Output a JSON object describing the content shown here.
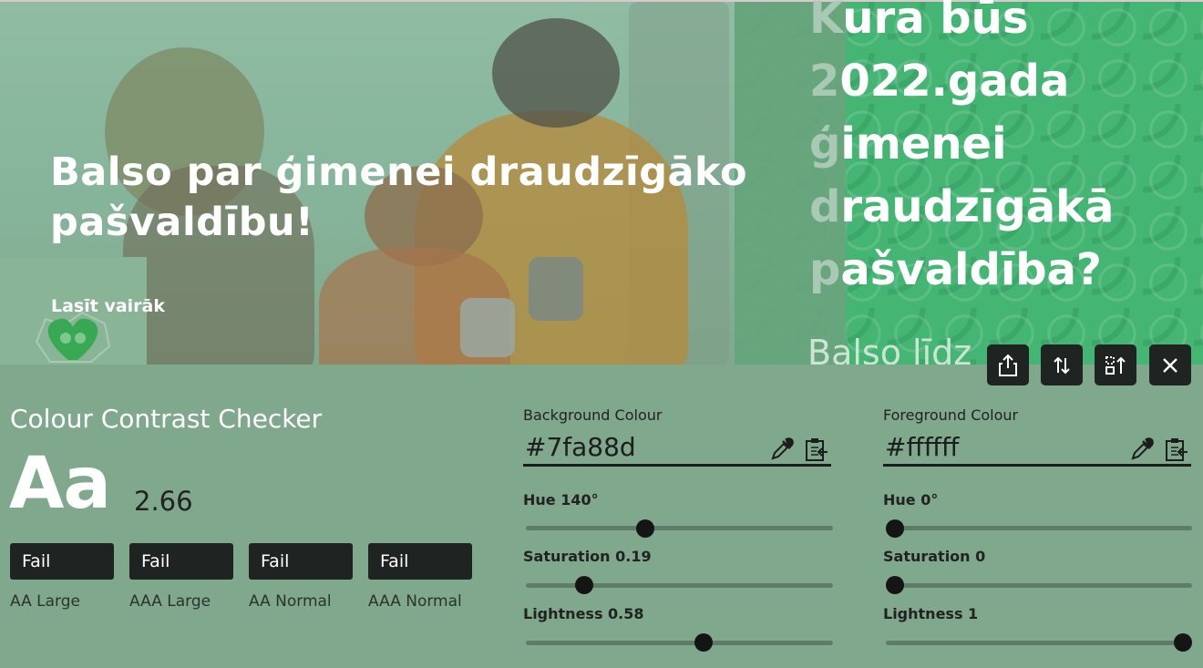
{
  "page": {
    "promo_heading_line1": "Balso par ģimenei draudzīgāko",
    "promo_heading_line2": "pašvaldību!",
    "read_more": "Lasīt vairāk",
    "question_lines": [
      "Kura būs",
      "2022.gada",
      "ģimenei",
      "draudzīgākā",
      "pašvaldība?"
    ],
    "balso": "Balso līdz"
  },
  "toolbar": {
    "buttons": [
      {
        "name": "export-button",
        "icon": "share-icon"
      },
      {
        "name": "swap-colours-button",
        "icon": "swap-arrows-icon"
      },
      {
        "name": "move-panel-button",
        "icon": "dock-move-icon"
      },
      {
        "name": "close-button",
        "icon": "close-icon"
      }
    ]
  },
  "checker": {
    "title": "Colour Contrast Checker",
    "sample_text": "Aa",
    "ratio": "2.66",
    "results": [
      {
        "status": "Fail",
        "label": "AA Large"
      },
      {
        "status": "Fail",
        "label": "AAA Large"
      },
      {
        "status": "Fail",
        "label": "AA Normal"
      },
      {
        "status": "Fail",
        "label": "AAA Normal"
      }
    ]
  },
  "background_colour": {
    "label": "Background Colour",
    "value": "#7fa88d",
    "hue_label": "Hue 140°",
    "hue": 140,
    "saturation_label": "Saturation 0.19",
    "saturation": 0.19,
    "lightness_label": "Lightness 0.58",
    "lightness": 0.58
  },
  "foreground_colour": {
    "label": "Foreground Colour",
    "value": "#ffffff",
    "hue_label": "Hue 0°",
    "hue": 0,
    "saturation_label": "Saturation 0",
    "saturation": 0,
    "lightness_label": "Lightness 1",
    "lightness": 1
  },
  "colors": {
    "panel_bg": "#7fa88d",
    "badge_bg": "#1f2321",
    "green_banner": "#45b574"
  }
}
